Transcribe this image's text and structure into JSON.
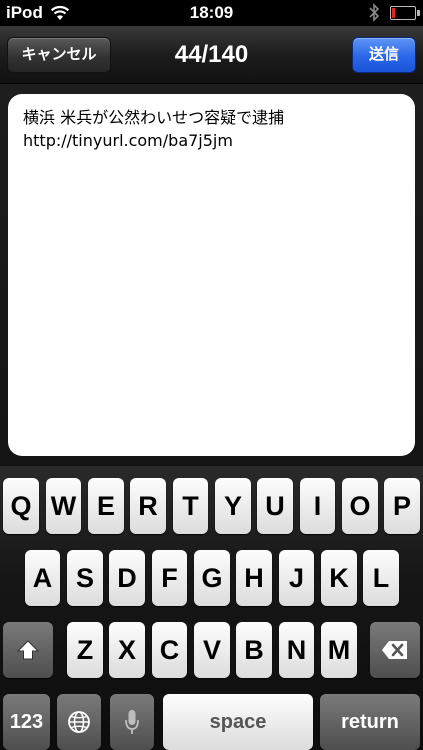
{
  "status_bar": {
    "carrier": "iPod",
    "time": "18:09",
    "wifi_icon": "wifi-icon",
    "bluetooth_icon": "bluetooth-icon",
    "battery_level": 0.15,
    "battery_color": "#e0261c"
  },
  "navbar": {
    "cancel_label": "キャンセル",
    "counter": "44/140",
    "send_label": "送信",
    "send_color": "#2a66e8"
  },
  "compose": {
    "lines": [
      "横浜 米兵が公然わいせつ容疑で逮捕",
      "http://tinyurl.com/ba7j5jm"
    ]
  },
  "keyboard": {
    "row1": [
      "Q",
      "W",
      "E",
      "R",
      "T",
      "Y",
      "U",
      "I",
      "O",
      "P"
    ],
    "row2": [
      "A",
      "S",
      "D",
      "F",
      "G",
      "H",
      "J",
      "K",
      "L"
    ],
    "row3": [
      "Z",
      "X",
      "C",
      "V",
      "B",
      "N",
      "M"
    ],
    "numbers_label": "123",
    "space_label": "space",
    "return_label": "return",
    "shift_icon": "shift-icon",
    "delete_icon": "delete-icon",
    "globe_icon": "globe-icon",
    "mic_icon": "microphone-icon"
  }
}
